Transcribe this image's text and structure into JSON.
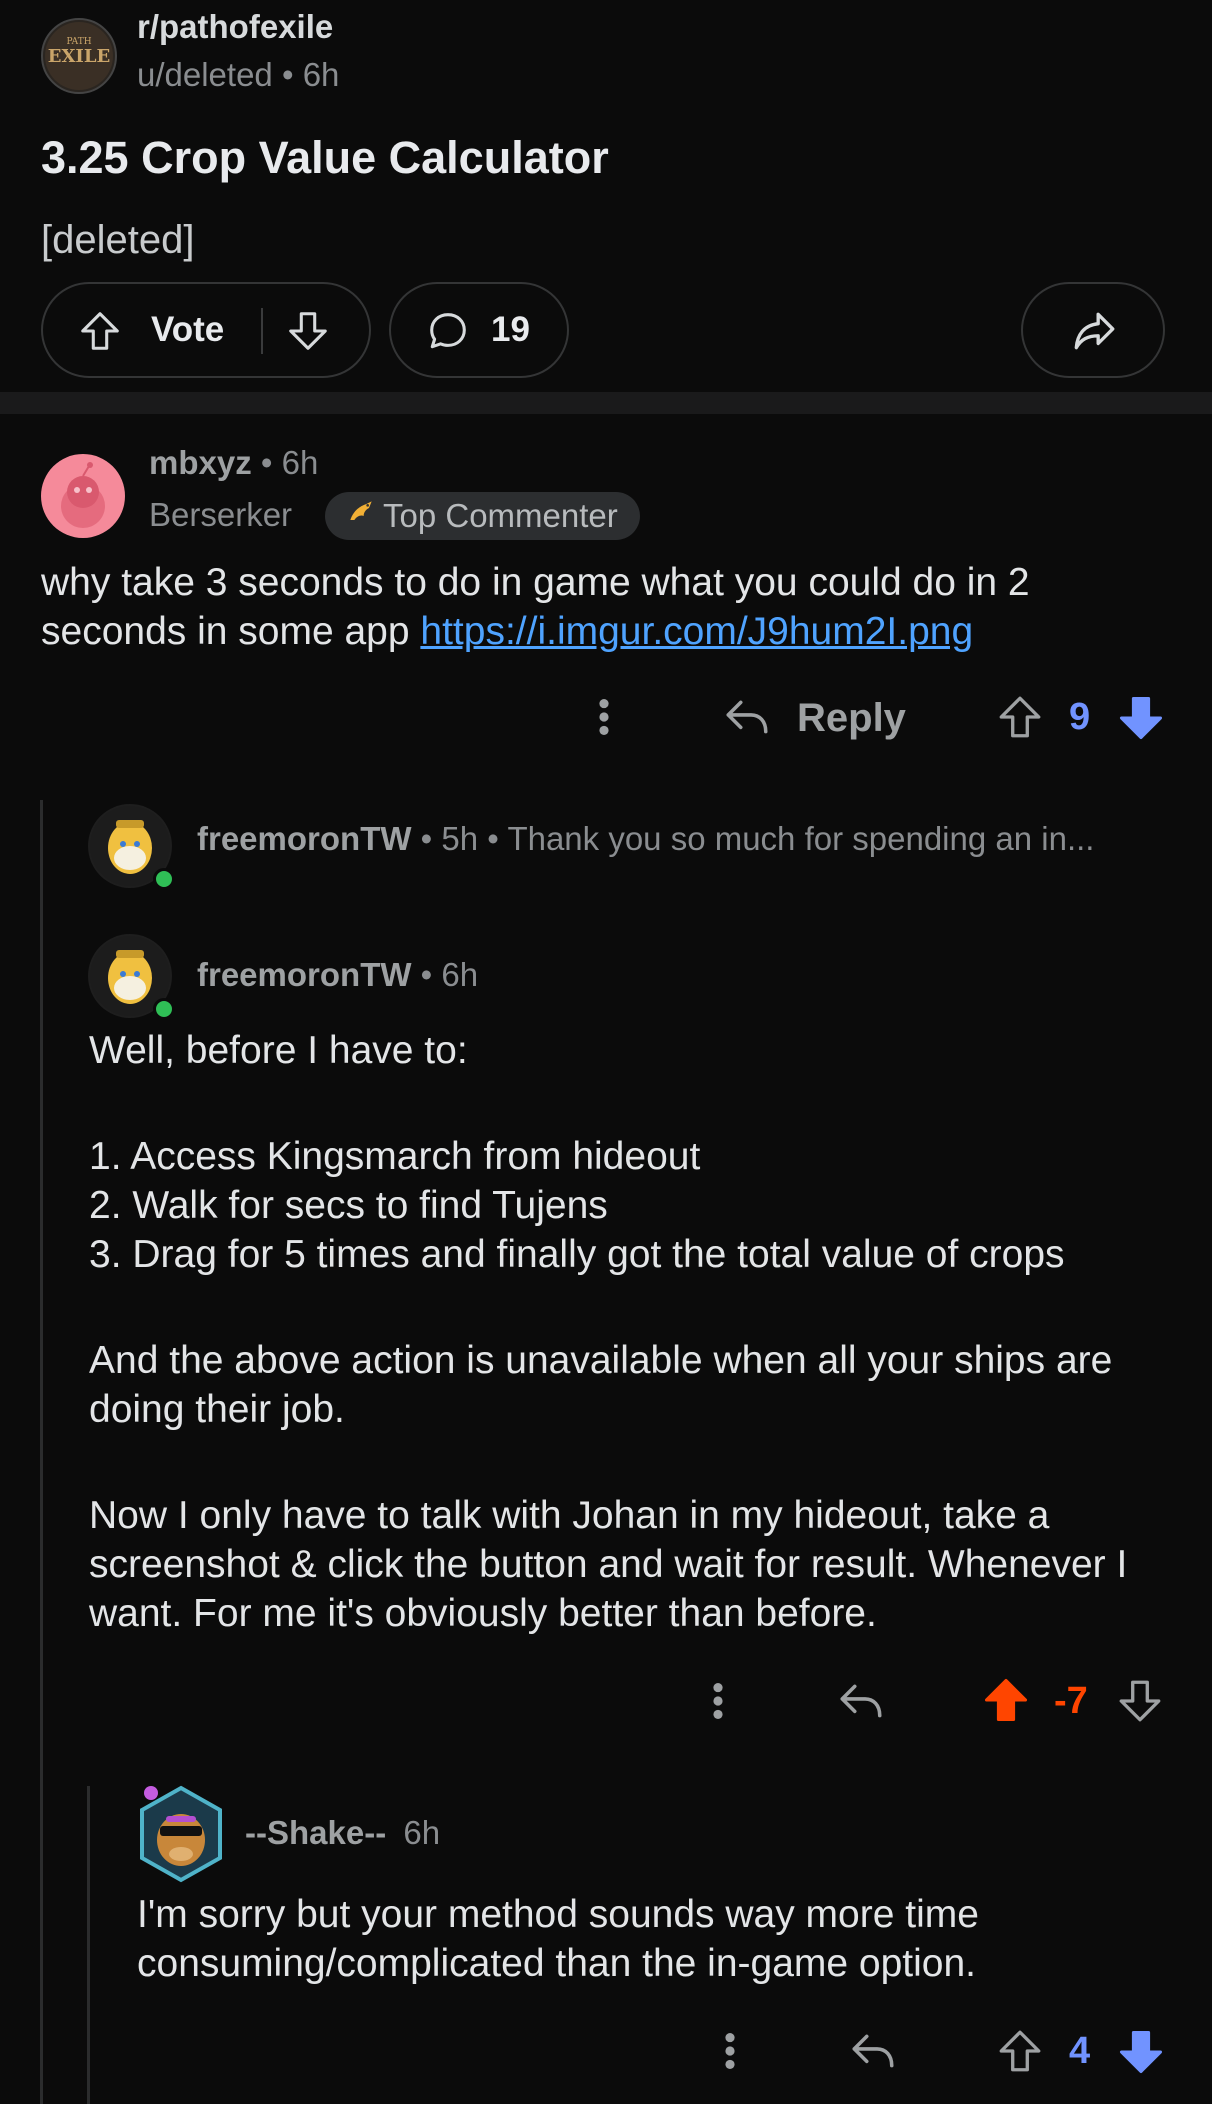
{
  "post": {
    "subreddit": "r/pathofexile",
    "author": "u/deleted",
    "age": "6h",
    "title": "3.25 Crop Value Calculator",
    "body": "[deleted]",
    "vote_label": "Vote",
    "comment_count": "19"
  },
  "comments": [
    {
      "author": "mbxyz",
      "age": "6h",
      "flair": "Berserker",
      "badge": "Top Commenter",
      "text": "why take 3 seconds to do in game what you could do in 2 seconds in some app",
      "link": "https://i.imgur.com/J9hum2I.png",
      "reply_label": "Reply",
      "score": "9"
    },
    {
      "author": "freemoronTW",
      "age": "5h",
      "preview": "Thank you so much for spending an in..."
    },
    {
      "author": "freemoronTW",
      "age": "6h",
      "p1": "Well, before I have to:",
      "list": [
        "1. Access Kingsmarch from hideout",
        "2. Walk for secs to find Tujens",
        "3. Drag for 5 times and finally got the total value of crops"
      ],
      "p2": "And the above action is unavailable when all your ships are doing their job.",
      "p3": "Now I only have to talk with Johan in my hideout, take a screenshot & click the button and wait for result. Whenever I want. For me it's obviously better than before.",
      "score": "-7"
    },
    {
      "author": "--Shake--",
      "age": "6h",
      "text": "I'm sorry but your method sounds way more time consuming/complicated than the in-game option.",
      "score": "4"
    }
  ],
  "colors": {
    "upvote": "#ff4500",
    "downvote": "#7193ff",
    "link": "#4fa3ff"
  }
}
